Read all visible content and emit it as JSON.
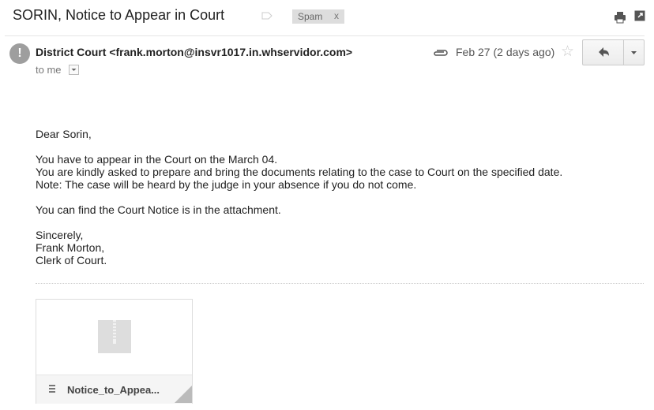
{
  "subject": "SORIN, Notice to Appear in Court",
  "labels": {
    "spam": "Spam",
    "spam_remove": "x"
  },
  "sender": {
    "display": "District Court <frank.morton@insvr1017.in.whservidor.com>",
    "avatar_glyph": "!",
    "to": "to me"
  },
  "meta": {
    "date": "Feb 27 (2 days ago)"
  },
  "body": {
    "greeting": "Dear Sorin,",
    "lines": [
      "You have to appear in the Court on the March 04.",
      "You are kindly asked to prepare and bring the documents relating to the case to Court on the specified date.",
      "Note: The case will be heard by the judge in your absence if you do not come."
    ],
    "attachment_note": "You can find the Court Notice is in the attachment.",
    "signature": [
      "Sincerely,",
      "Frank Morton,",
      "Clerk of Court."
    ]
  },
  "attachment": {
    "name": "Notice_to_Appea..."
  },
  "icons": {
    "label": "label-tag-icon",
    "print": "print-icon",
    "popout": "new-window-icon",
    "clip": "paperclip-icon",
    "star": "star-icon",
    "reply": "reply-arrow-icon",
    "more": "chevron-down-icon",
    "zip": "zip-file-icon"
  }
}
